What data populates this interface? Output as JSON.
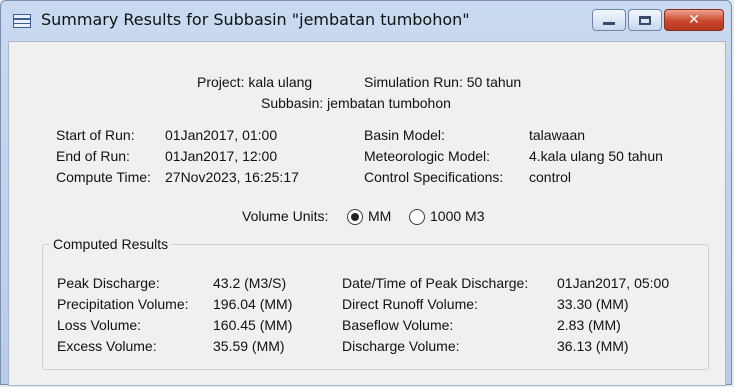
{
  "window": {
    "title": "Summary Results for Subbasin \"jembatan tumbohon\"",
    "buttons": {
      "minimize": "minimize-icon",
      "maximize": "maximize-icon",
      "close": "close-icon"
    }
  },
  "header": {
    "project": "Project: kala ulang",
    "simulation_run": "Simulation Run: 50 tahun",
    "subbasin": "Subbasin: jembatan tumbohon"
  },
  "run_info": {
    "start_label": "Start of Run:",
    "start_value": "01Jan2017, 01:00",
    "end_label": "End of Run:",
    "end_value": "01Jan2017, 12:00",
    "compute_label": "Compute Time:",
    "compute_value": "27Nov2023, 16:25:17",
    "basin_label": "Basin Model:",
    "basin_value": "talawaan",
    "met_label": "Meteorologic Model:",
    "met_value": "4.kala ulang 50 tahun",
    "control_label": "Control Specifications:",
    "control_value": "control"
  },
  "volume_units": {
    "label": "Volume Units:",
    "options": [
      "MM",
      "1000 M3"
    ],
    "selected": "MM"
  },
  "results": {
    "group_title": "Computed Results",
    "peak_discharge_label": "Peak Discharge:",
    "peak_discharge_value": "43.2 (M3/S)",
    "precip_label": "Precipitation Volume:",
    "precip_value": "196.04 (MM)",
    "loss_label": "Loss Volume:",
    "loss_value": "160.45 (MM)",
    "excess_label": "Excess Volume:",
    "excess_value": "35.59 (MM)",
    "peak_time_label": "Date/Time of Peak Discharge:",
    "peak_time_value": "01Jan2017, 05:00",
    "direct_runoff_label": "Direct Runoff Volume:",
    "direct_runoff_value": "33.30 (MM)",
    "baseflow_label": "Baseflow Volume:",
    "baseflow_value": "2.83 (MM)",
    "discharge_label": "Discharge Volume:",
    "discharge_value": "36.13 (MM)"
  }
}
